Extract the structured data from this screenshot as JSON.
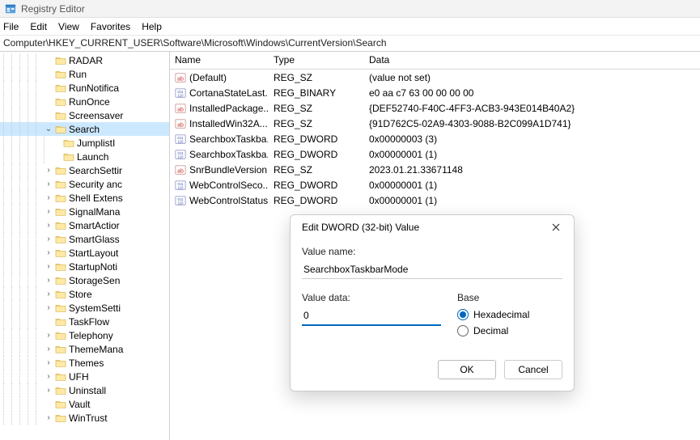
{
  "window": {
    "title": "Registry Editor"
  },
  "menu": {
    "file": "File",
    "edit": "Edit",
    "view": "View",
    "favorites": "Favorites",
    "help": "Help"
  },
  "address": {
    "path": "Computer\\HKEY_CURRENT_USER\\Software\\Microsoft\\Windows\\CurrentVersion\\Search"
  },
  "tree": {
    "items": [
      {
        "label": "RADAR",
        "expander": "",
        "depth": 5,
        "selected": false
      },
      {
        "label": "Run",
        "expander": "",
        "depth": 5,
        "selected": false
      },
      {
        "label": "RunNotifica",
        "expander": "",
        "depth": 5,
        "selected": false
      },
      {
        "label": "RunOnce",
        "expander": "",
        "depth": 5,
        "selected": false
      },
      {
        "label": "Screensaver",
        "expander": "",
        "depth": 5,
        "selected": false
      },
      {
        "label": "Search",
        "expander": "⌄",
        "depth": 5,
        "selected": true
      },
      {
        "label": "JumplistI",
        "expander": "",
        "depth": 6,
        "selected": false
      },
      {
        "label": "Launch",
        "expander": "",
        "depth": 6,
        "selected": false
      },
      {
        "label": "SearchSettir",
        "expander": "›",
        "depth": 5,
        "selected": false
      },
      {
        "label": "Security anc",
        "expander": "›",
        "depth": 5,
        "selected": false
      },
      {
        "label": "Shell Extens",
        "expander": "›",
        "depth": 5,
        "selected": false
      },
      {
        "label": "SignalMana",
        "expander": "›",
        "depth": 5,
        "selected": false
      },
      {
        "label": "SmartActior",
        "expander": "›",
        "depth": 5,
        "selected": false
      },
      {
        "label": "SmartGlass",
        "expander": "›",
        "depth": 5,
        "selected": false
      },
      {
        "label": "StartLayout",
        "expander": "›",
        "depth": 5,
        "selected": false
      },
      {
        "label": "StartupNoti",
        "expander": "›",
        "depth": 5,
        "selected": false
      },
      {
        "label": "StorageSen",
        "expander": "›",
        "depth": 5,
        "selected": false
      },
      {
        "label": "Store",
        "expander": "›",
        "depth": 5,
        "selected": false
      },
      {
        "label": "SystemSetti",
        "expander": "›",
        "depth": 5,
        "selected": false
      },
      {
        "label": "TaskFlow",
        "expander": "",
        "depth": 5,
        "selected": false
      },
      {
        "label": "Telephony",
        "expander": "›",
        "depth": 5,
        "selected": false
      },
      {
        "label": "ThemeMana",
        "expander": "›",
        "depth": 5,
        "selected": false
      },
      {
        "label": "Themes",
        "expander": "›",
        "depth": 5,
        "selected": false
      },
      {
        "label": "UFH",
        "expander": "›",
        "depth": 5,
        "selected": false
      },
      {
        "label": "Uninstall",
        "expander": "›",
        "depth": 5,
        "selected": false
      },
      {
        "label": "Vault",
        "expander": "",
        "depth": 5,
        "selected": false
      },
      {
        "label": "WinTrust",
        "expander": "›",
        "depth": 5,
        "selected": false
      }
    ]
  },
  "list": {
    "headers": {
      "name": "Name",
      "type": "Type",
      "data": "Data"
    },
    "rows": [
      {
        "icon": "sz",
        "name": "(Default)",
        "type": "REG_SZ",
        "data": "(value not set)"
      },
      {
        "icon": "bin",
        "name": "CortanaStateLast...",
        "type": "REG_BINARY",
        "data": "e0 aa c7 63 00 00 00 00"
      },
      {
        "icon": "sz",
        "name": "InstalledPackage...",
        "type": "REG_SZ",
        "data": "{DEF52740-F40C-4FF3-ACB3-943E014B40A2}"
      },
      {
        "icon": "sz",
        "name": "InstalledWin32A...",
        "type": "REG_SZ",
        "data": "{91D762C5-02A9-4303-9088-B2C099A1D741}"
      },
      {
        "icon": "bin",
        "name": "SearchboxTaskba...",
        "type": "REG_DWORD",
        "data": "0x00000003 (3)"
      },
      {
        "icon": "bin",
        "name": "SearchboxTaskba...",
        "type": "REG_DWORD",
        "data": "0x00000001 (1)"
      },
      {
        "icon": "sz",
        "name": "SnrBundleVersion",
        "type": "REG_SZ",
        "data": "2023.01.21.33671148"
      },
      {
        "icon": "bin",
        "name": "WebControlSeco...",
        "type": "REG_DWORD",
        "data": "0x00000001 (1)"
      },
      {
        "icon": "bin",
        "name": "WebControlStatus",
        "type": "REG_DWORD",
        "data": "0x00000001 (1)"
      }
    ]
  },
  "dialog": {
    "title": "Edit DWORD (32-bit) Value",
    "value_name_label": "Value name:",
    "value_name": "SearchboxTaskbarMode",
    "value_data_label": "Value data:",
    "value_data": "0",
    "base_label": "Base",
    "radio_hex": "Hexadecimal",
    "radio_dec": "Decimal",
    "ok": "OK",
    "cancel": "Cancel"
  }
}
